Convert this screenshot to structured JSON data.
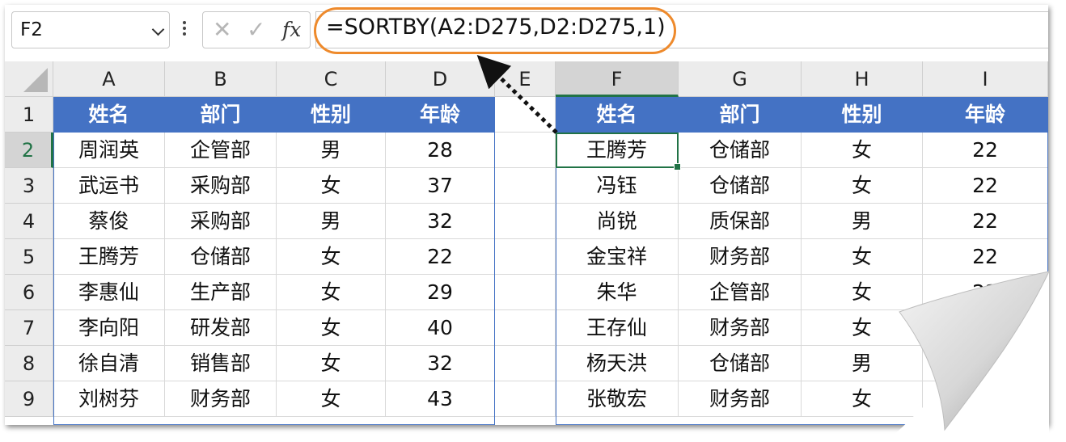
{
  "name_box": {
    "value": "F2"
  },
  "formula_bar": {
    "cancel_symbol": "✕",
    "enter_symbol": "✓",
    "fx_label": "fx",
    "formula": "=SORTBY(A2:D275,D2:D275,1)"
  },
  "columns": [
    "A",
    "B",
    "C",
    "D",
    "E",
    "F",
    "G",
    "H",
    "I"
  ],
  "selected_column": "F",
  "rows": [
    "1",
    "2",
    "3",
    "4",
    "5",
    "6",
    "7",
    "8",
    "9"
  ],
  "selected_row": "2",
  "active_cell": "F2",
  "source_table": {
    "headers": [
      "姓名",
      "部门",
      "性别",
      "年龄"
    ],
    "rows": [
      [
        "周润英",
        "企管部",
        "男",
        "28"
      ],
      [
        "武运书",
        "采购部",
        "女",
        "37"
      ],
      [
        "蔡俊",
        "采购部",
        "男",
        "32"
      ],
      [
        "王腾芳",
        "仓储部",
        "女",
        "22"
      ],
      [
        "李惠仙",
        "生产部",
        "女",
        "29"
      ],
      [
        "李向阳",
        "研发部",
        "女",
        "40"
      ],
      [
        "徐自清",
        "销售部",
        "女",
        "32"
      ],
      [
        "刘树芬",
        "财务部",
        "女",
        "43"
      ]
    ]
  },
  "sorted_table": {
    "headers": [
      "姓名",
      "部门",
      "性别",
      "年龄"
    ],
    "rows": [
      [
        "王腾芳",
        "仓储部",
        "女",
        "22"
      ],
      [
        "冯钰",
        "仓储部",
        "女",
        "22"
      ],
      [
        "尚锐",
        "质保部",
        "男",
        "22"
      ],
      [
        "金宝祥",
        "财务部",
        "女",
        "22"
      ],
      [
        "朱华",
        "企管部",
        "女",
        "22"
      ],
      [
        "王存仙",
        "财务部",
        "女",
        ""
      ],
      [
        "杨天洪",
        "仓储部",
        "男",
        ""
      ],
      [
        "张敬宏",
        "财务部",
        "女",
        ""
      ]
    ]
  },
  "colors": {
    "header_fill": "#4472c4",
    "highlight_oval": "#ee8a2c",
    "selection_green": "#217346"
  }
}
